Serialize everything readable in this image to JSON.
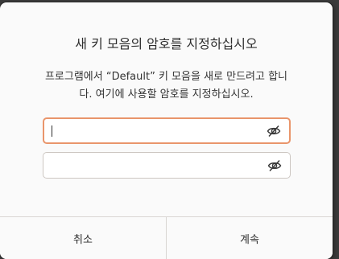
{
  "dialog": {
    "title": "새 키 모음의 암호를 지정하십시오",
    "message_line1": "프로그램에서 “Default” 키 모음을 새로 만드려고 합니",
    "message_line2": "다. 여기에 사용할 암호를 지정하십시오.",
    "password_field": {
      "value": "",
      "placeholder": "",
      "icon": "eye-slash-icon"
    },
    "confirm_field": {
      "value": "",
      "placeholder": "",
      "icon": "eye-slash-icon"
    },
    "buttons": {
      "cancel_label": "취소",
      "continue_label": "계속"
    }
  },
  "colors": {
    "focus_border": "#e9956b",
    "dialog_bg": "#fafafa",
    "field_border": "#cdc7c2"
  }
}
